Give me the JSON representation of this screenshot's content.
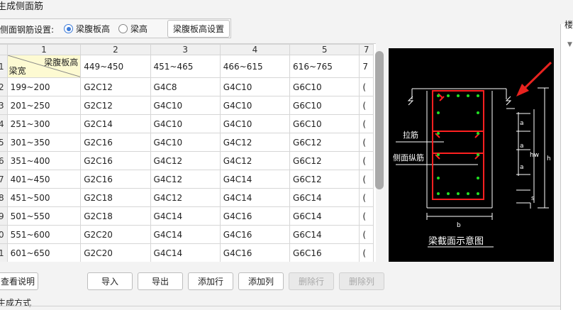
{
  "window": {
    "title": "生成侧面筋"
  },
  "options": {
    "label": "侧面钢筋设置:",
    "radio_web_height": "梁腹板高",
    "radio_beam_height": "梁高",
    "settings_button": "梁腹板高设置",
    "selected": "梁腹板高"
  },
  "grid": {
    "col_numbers": [
      "1",
      "2",
      "3",
      "4",
      "5",
      "7"
    ],
    "header_top": "梁腹板高",
    "header_bottom": "梁宽",
    "header_row_index": "1",
    "height_ranges": [
      "449~450",
      "451~465",
      "466~615",
      "616~765",
      "7"
    ],
    "rows": [
      {
        "idx": "2",
        "width": "199~200",
        "c2": "G2C12",
        "c3": "G4C8",
        "c4": "G4C10",
        "c5": "G6C10",
        "c6": "("
      },
      {
        "idx": "3",
        "width": "201~250",
        "c2": "G2C12",
        "c3": "G4C10",
        "c4": "G4C10",
        "c5": "G6C10",
        "c6": "("
      },
      {
        "idx": "4",
        "width": "251~300",
        "c2": "G2C14",
        "c3": "G4C10",
        "c4": "G4C10",
        "c5": "G6C10",
        "c6": "("
      },
      {
        "idx": "5",
        "width": "301~350",
        "c2": "G2C16",
        "c3": "G4C10",
        "c4": "G4C12",
        "c5": "G6C12",
        "c6": "("
      },
      {
        "idx": "6",
        "width": "351~400",
        "c2": "G2C16",
        "c3": "G4C12",
        "c4": "G4C12",
        "c5": "G6C12",
        "c6": "("
      },
      {
        "idx": "7",
        "width": "401~450",
        "c2": "G2C16",
        "c3": "G4C12",
        "c4": "G4C14",
        "c5": "G6C12",
        "c6": "("
      },
      {
        "idx": "8",
        "width": "451~500",
        "c2": "G2C18",
        "c3": "G4C12",
        "c4": "G4C14",
        "c5": "G6C14",
        "c6": "("
      },
      {
        "idx": "9",
        "width": "501~550",
        "c2": "G2C18",
        "c3": "G4C14",
        "c4": "G4C16",
        "c5": "G6C14",
        "c6": "("
      },
      {
        "idx": "0",
        "width": "551~600",
        "c2": "G2C20",
        "c3": "G4C14",
        "c4": "G4C16",
        "c5": "G6C14",
        "c6": "("
      },
      {
        "idx": "1",
        "width": "601~650",
        "c2": "G2C20",
        "c3": "G4C14",
        "c4": "G4C16",
        "c5": "G6C16",
        "c6": "("
      }
    ]
  },
  "diagram": {
    "caption": "梁截面示意图",
    "tie_label": "拉筋",
    "side_bar_label": "侧面纵筋",
    "dim_a": "a",
    "dim_hw": "hw",
    "dim_h": "h",
    "dim_s": "s",
    "dim_b": "b",
    "colors": {
      "bg": "#000000",
      "rebar": "#ff2020",
      "dot": "#22dd22",
      "line": "#ffffff",
      "arrow": "#e8231f"
    }
  },
  "buttons": {
    "help": "查看说明",
    "import": "导入",
    "export": "导出",
    "add_row": "添加行",
    "add_col": "添加列",
    "del_row": "删除行",
    "del_col": "删除列"
  },
  "footer": {
    "gen_label": "生成方式"
  },
  "right_panel": {
    "label": "楼"
  }
}
